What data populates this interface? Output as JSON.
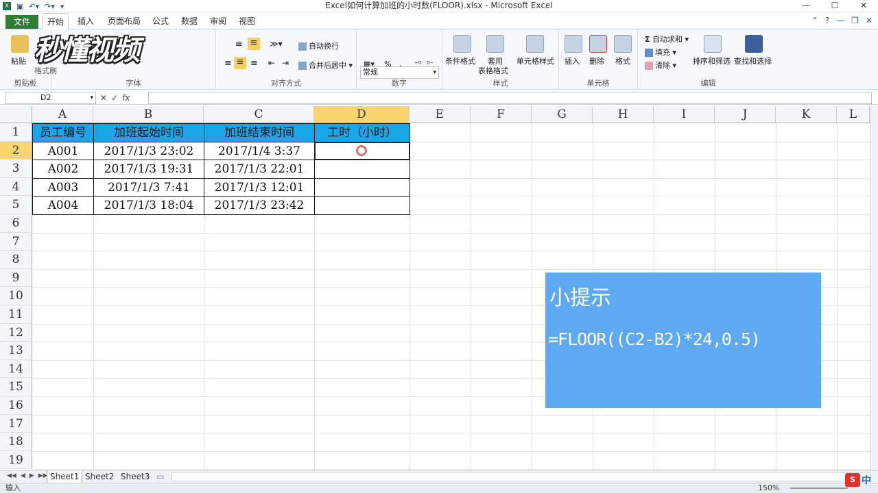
{
  "window": {
    "title": "Excel如何计算加班的小时数(FLOOR).xlsx - Microsoft Excel"
  },
  "tabs": [
    "文件",
    "开始",
    "插入",
    "页面布局",
    "公式",
    "数据",
    "审阅",
    "视图"
  ],
  "ribbon": {
    "clipboard": {
      "paste": "粘贴",
      "format_painter": "格式刷",
      "group": "剪贴板"
    },
    "font": {
      "group": "字体"
    },
    "alignment": {
      "wrap": "自动换行",
      "merge": "合并后居中",
      "group": "对齐方式"
    },
    "number": {
      "format": "常规",
      "percent": "%",
      "comma": ",",
      "group": "数字"
    },
    "styles": {
      "cond": "条件格式",
      "table1": "套用",
      "table2": "表格格式",
      "cell": "单元格样式",
      "group": "样式"
    },
    "cells": {
      "insert": "插入",
      "delete": "删除",
      "format": "格式",
      "group": "单元格"
    },
    "editing": {
      "autosum": "自动求和",
      "fill": "填充",
      "clear": "清除",
      "sort": "排序和筛选",
      "find": "查找和选择",
      "group": "编辑",
      "sigma": "Σ"
    },
    "logo": "秒懂视频"
  },
  "formula_bar": {
    "name_box": "D2",
    "fx": "fx",
    "cancel": "✕",
    "enter": "✓",
    "value": ""
  },
  "columns": [
    "A",
    "B",
    "C",
    "D",
    "E",
    "F",
    "G",
    "H",
    "I",
    "J",
    "K",
    "L"
  ],
  "rows": [
    "1",
    "2",
    "3",
    "4",
    "5",
    "6",
    "7",
    "8",
    "9",
    "10",
    "11",
    "12",
    "13",
    "14",
    "15",
    "16",
    "17",
    "18",
    "19"
  ],
  "table": {
    "headers": [
      "员工编号",
      "加班起始时间",
      "加班结束时间",
      "工时（小时）"
    ],
    "rows": [
      [
        "A001",
        "2017/1/3 23:02",
        "2017/1/4 3:37",
        ""
      ],
      [
        "A002",
        "2017/1/3 19:31",
        "2017/1/3 22:01",
        ""
      ],
      [
        "A003",
        "2017/1/3 7:41",
        "2017/1/3 12:01",
        ""
      ],
      [
        "A004",
        "2017/1/3 18:04",
        "2017/1/3 23:42",
        ""
      ]
    ]
  },
  "hint": {
    "title": "小提示",
    "formula": "=FLOOR((C2-B2)*24,0.5)"
  },
  "sheets": [
    "Sheet1",
    "Sheet2",
    "Sheet3"
  ],
  "status": {
    "mode": "输入",
    "zoom": "150%"
  },
  "ime": {
    "badge": "S",
    "lang": "中"
  },
  "colors": {
    "header_fill": "#1aa7e8",
    "hint_fill": "#5eaaf2",
    "file_tab": "#2e7d32",
    "selected_header": "#f9d46f"
  }
}
